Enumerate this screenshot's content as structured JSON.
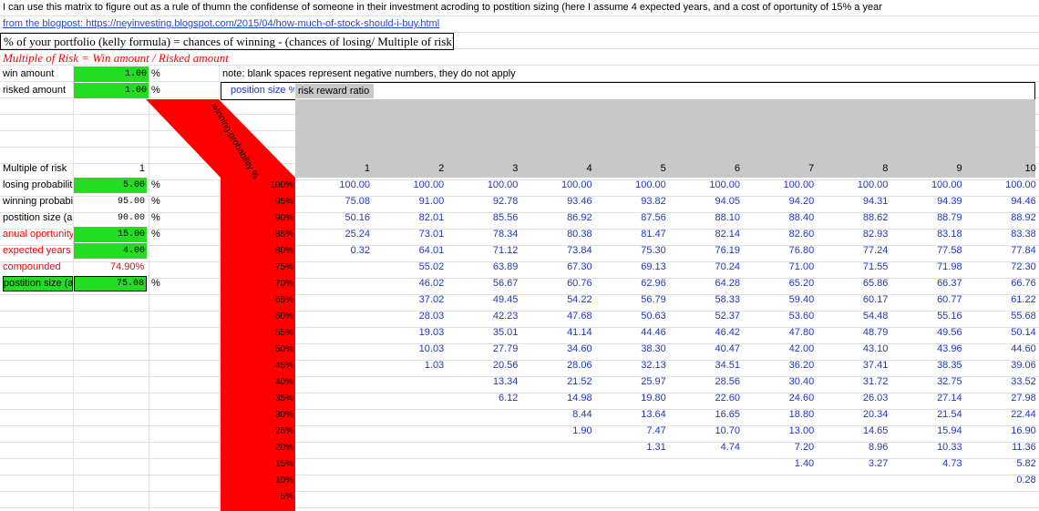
{
  "header": {
    "intro": "I can use this matrix to figure out as a rule of thumn the confidense of someone in their investment acroding to postition sizing (here I assume 4 expected years, and a cost of oportunity of 15% a year",
    "link": "from the blogpost: https://neyinvesting.blogspot.com/2015/04/how-much-of-stock-should-i-buy.html",
    "kelly_formula": "% of your portfolio (kelly formula) = chances of winning - (chances of losing/ Multiple of risk)",
    "multiple_of_risk_formula": "Multiple of Risk = Win amount / Risked amount"
  },
  "inputs": {
    "win_amount_label": "win amount",
    "win_amount_value": "1.00",
    "risked_amount_label": "risked amount",
    "risked_amount_value": "1.00",
    "percent": "%"
  },
  "note": "note: blank spaces represent negative numbers, they do not apply",
  "matrix_header": {
    "position_size_label": "position size %",
    "risk_reward_label": "risk reward ratio",
    "winning_probability_label": "winning probability %"
  },
  "calc": {
    "rows": [
      {
        "label": "Multiple of risk",
        "value": "1",
        "unit": ""
      },
      {
        "label": "losing probabilit",
        "value": "5.00",
        "unit": "%"
      },
      {
        "label": "winning probabi",
        "value": "95.00",
        "unit": "%"
      },
      {
        "label": "postition size (as",
        "value": "90.00",
        "unit": "%"
      },
      {
        "label": "anual oportunity",
        "value": "15.00",
        "unit": "%"
      },
      {
        "label": "expected years",
        "value": "4.00",
        "unit": ""
      },
      {
        "label": "compounded",
        "value": "74.90%",
        "unit": ""
      },
      {
        "label": "postition size (as",
        "value": "75.08",
        "unit": "%"
      }
    ]
  },
  "matrix": {
    "ratios": [
      "1",
      "2",
      "3",
      "4",
      "5",
      "6",
      "7",
      "8",
      "9",
      "10"
    ],
    "probabilities": [
      "100%",
      "95%",
      "90%",
      "85%",
      "80%",
      "75%",
      "70%",
      "65%",
      "60%",
      "55%",
      "50%",
      "45%",
      "40%",
      "35%",
      "30%",
      "25%",
      "20%",
      "15%",
      "10%",
      "5%"
    ],
    "columns": [
      [
        "100.00",
        "75.08",
        "50.16",
        "25.24",
        "0.32",
        "",
        "",
        "",
        "",
        "",
        "",
        "",
        "",
        "",
        "",
        "",
        "",
        "",
        "",
        ""
      ],
      [
        "100.00",
        "91.00",
        "82.01",
        "73.01",
        "64.01",
        "55.02",
        "46.02",
        "37.02",
        "28.03",
        "19.03",
        "10.03",
        "1.03",
        "",
        "",
        "",
        "",
        "",
        "",
        "",
        ""
      ],
      [
        "100.00",
        "92.78",
        "85.56",
        "78.34",
        "71.12",
        "63.89",
        "56.67",
        "49.45",
        "42.23",
        "35.01",
        "27.79",
        "20.56",
        "13.34",
        "6.12",
        "",
        "",
        "",
        "",
        "",
        ""
      ],
      [
        "100.00",
        "93.46",
        "86.92",
        "80.38",
        "73.84",
        "67.30",
        "60.76",
        "54.22",
        "47.68",
        "41.14",
        "34.60",
        "28.06",
        "21.52",
        "14.98",
        "8.44",
        "1.90",
        "",
        "",
        "",
        ""
      ],
      [
        "100.00",
        "93.82",
        "87.56",
        "81.47",
        "75.30",
        "69.13",
        "62.96",
        "56.79",
        "50.63",
        "44.46",
        "38.30",
        "32.13",
        "25.97",
        "19.80",
        "13.64",
        "7.47",
        "1.31",
        "",
        "",
        ""
      ],
      [
        "100.00",
        "94.05",
        "88.10",
        "82.14",
        "76.19",
        "70.24",
        "64.28",
        "58.33",
        "52.37",
        "46.42",
        "40.47",
        "34.51",
        "28.56",
        "22.60",
        "16.65",
        "10.70",
        "4.74",
        "",
        "",
        ""
      ],
      [
        "100.00",
        "94.20",
        "88.40",
        "82.60",
        "76.80",
        "71.00",
        "65.20",
        "59.40",
        "53.60",
        "47.80",
        "42.00",
        "36.20",
        "30.40",
        "24.60",
        "18.80",
        "13.00",
        "7.20",
        "1.40",
        "",
        ""
      ],
      [
        "100.00",
        "94.31",
        "88.62",
        "82.93",
        "77.24",
        "71.55",
        "65.86",
        "60.17",
        "54.48",
        "48.79",
        "43.10",
        "37.41",
        "31.72",
        "26.03",
        "20.34",
        "14.65",
        "8.96",
        "3.27",
        "",
        ""
      ],
      [
        "100.00",
        "94.39",
        "88.79",
        "83.18",
        "77.58",
        "71.98",
        "66.37",
        "60.77",
        "55.16",
        "49.56",
        "43.96",
        "38.35",
        "32.75",
        "27.14",
        "21.54",
        "15.94",
        "10.33",
        "4.73",
        "",
        ""
      ],
      [
        "100.00",
        "94.46",
        "88.92",
        "83.38",
        "77.84",
        "72.30",
        "66.76",
        "61.22",
        "55.68",
        "50.14",
        "44.60",
        "39.06",
        "33.52",
        "27.98",
        "22.44",
        "16.90",
        "11.36",
        "5.82",
        "0.28",
        ""
      ]
    ]
  },
  "colors": {
    "input_green": "#22dd22",
    "band_red": "#ff0000",
    "number_blue": "#1f36c9",
    "header_gray": "#c8c8c8"
  }
}
